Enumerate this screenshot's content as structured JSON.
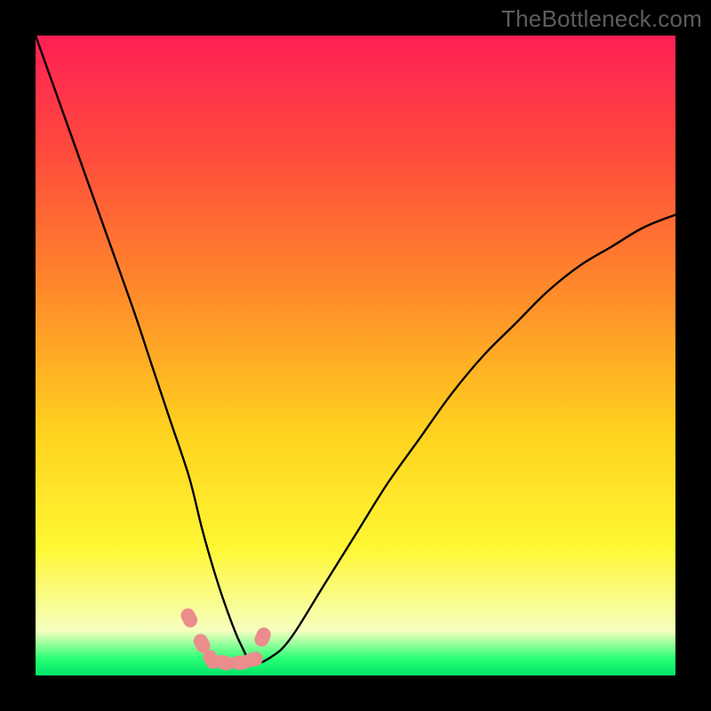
{
  "watermark": "TheBottleneck.com",
  "colors": {
    "frame_bg": "#000000",
    "curve_stroke": "#000000",
    "marker_fill": "#eb8d8d",
    "marker_stroke": "#eb8d8d",
    "gradient_stops": [
      {
        "offset": 0.0,
        "color": "#ff1f56"
      },
      {
        "offset": 0.18,
        "color": "#ff4a3d"
      },
      {
        "offset": 0.4,
        "color": "#ff8a2a"
      },
      {
        "offset": 0.62,
        "color": "#ffd21f"
      },
      {
        "offset": 0.8,
        "color": "#fff733"
      },
      {
        "offset": 0.93,
        "color": "#f6ffbf"
      },
      {
        "offset": 0.974,
        "color": "#29ff74"
      },
      {
        "offset": 1.0,
        "color": "#00e36a"
      }
    ]
  },
  "chart_data": {
    "type": "line",
    "title": "",
    "xlabel": "",
    "ylabel": "",
    "ylim": [
      0,
      100
    ],
    "xlim": [
      0,
      100
    ],
    "series": [
      {
        "name": "bottleneck-curve",
        "x": [
          0,
          5,
          10,
          15,
          18,
          21,
          24,
          26,
          28,
          30,
          32,
          34,
          37,
          40,
          45,
          50,
          55,
          60,
          65,
          70,
          75,
          80,
          85,
          90,
          95,
          100
        ],
        "values": [
          100,
          86,
          72,
          58,
          49,
          40,
          31,
          23,
          16,
          10,
          5,
          2,
          3,
          6,
          14,
          22,
          30,
          37,
          44,
          50,
          55,
          60,
          64,
          67,
          70,
          72
        ]
      }
    ],
    "markers": {
      "name": "highlight-points",
      "x": [
        24.0,
        26.0,
        27.5,
        29.5,
        32.0,
        34.0,
        35.5
      ],
      "values": [
        9.0,
        5.0,
        2.5,
        2.0,
        2.0,
        2.5,
        6.0
      ]
    }
  }
}
